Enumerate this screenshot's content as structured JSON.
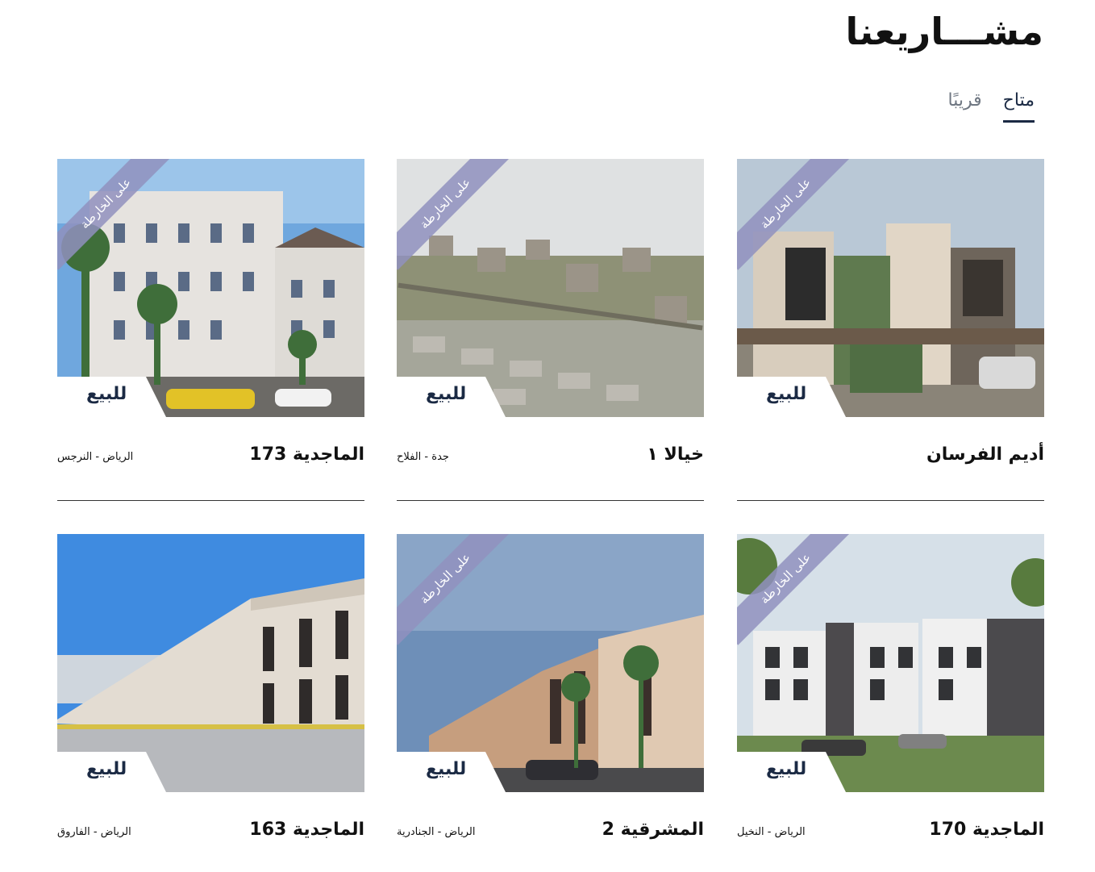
{
  "page": {
    "title": "مشـــاريعنا"
  },
  "tabs": [
    {
      "label": "متاح",
      "active": true
    },
    {
      "label": "قريبًا",
      "active": false
    }
  ],
  "ribbon_label": "على الخارطة",
  "sale_label": "للبيع",
  "projects": [
    {
      "name": "أديم الفرسان",
      "location": "",
      "ribbon": true
    },
    {
      "name": "خيالا ١",
      "location": "جدة - الفلاح",
      "ribbon": true
    },
    {
      "name": "الماجدية 173",
      "location": "الرياض - النرجس",
      "ribbon": true
    },
    {
      "name": "الماجدية 170",
      "location": "الرياض - النخيل",
      "ribbon": true
    },
    {
      "name": "المشرقية 2",
      "location": "الرياض - الجنادرية",
      "ribbon": true
    },
    {
      "name": "الماجدية 163",
      "location": "الرياض - الفاروق",
      "ribbon": false
    }
  ],
  "colors": {
    "accent": "#1b2a44",
    "ribbon": "#9191be",
    "muted_tab": "#6f7782"
  }
}
